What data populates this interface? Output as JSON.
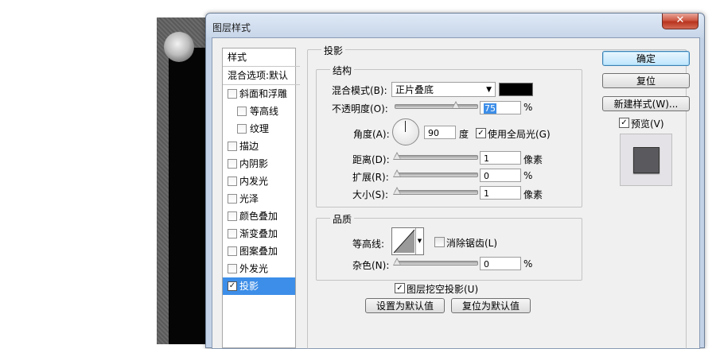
{
  "dialog": {
    "title": "图层样式",
    "close_glyph": "✕",
    "styles_header": "样式",
    "blend_default": "混合选项:默认",
    "style_items": [
      {
        "label": "斜面和浮雕",
        "checked": false
      },
      {
        "label": "等高线",
        "checked": false
      },
      {
        "label": "纹理",
        "checked": false
      },
      {
        "label": "描边",
        "checked": false
      },
      {
        "label": "内阴影",
        "checked": false
      },
      {
        "label": "内发光",
        "checked": false
      },
      {
        "label": "光泽",
        "checked": false
      },
      {
        "label": "颜色叠加",
        "checked": false
      },
      {
        "label": "渐变叠加",
        "checked": false
      },
      {
        "label": "图案叠加",
        "checked": false
      },
      {
        "label": "外发光",
        "checked": false
      },
      {
        "label": "投影",
        "checked": true
      }
    ],
    "check_glyph": "✓"
  },
  "drop_shadow": {
    "group_title": "投影",
    "structure_title": "结构",
    "blend_mode_label": "混合模式(B):",
    "blend_mode_value": "正片叠底",
    "blend_color": "#000000",
    "opacity_label": "不透明度(O):",
    "opacity_value": "75",
    "opacity_unit": "%",
    "angle_label": "角度(A):",
    "angle_value": "90",
    "angle_unit": "度",
    "global_light_label": "使用全局光(G)",
    "global_light_checked": true,
    "distance_label": "距离(D):",
    "distance_value": "1",
    "distance_unit": "像素",
    "spread_label": "扩展(R):",
    "spread_value": "0",
    "spread_unit": "%",
    "size_label": "大小(S):",
    "size_value": "1",
    "size_unit": "像素",
    "quality_title": "品质",
    "contour_label": "等高线:",
    "antialias_label": "消除锯齿(L)",
    "antialias_checked": false,
    "noise_label": "杂色(N):",
    "noise_value": "0",
    "noise_unit": "%",
    "knockout_label": "图层挖空投影(U)",
    "knockout_checked": true,
    "make_default_label": "设置为默认值",
    "reset_default_label": "复位为默认值"
  },
  "actions": {
    "ok_label": "确定",
    "reset_label": "复位",
    "new_style_label": "新建样式(W)...",
    "preview_label": "预览(V)",
    "preview_checked": true
  },
  "colors": {
    "selection": "#3d8ee8",
    "preview_swatch": "#5a5a5e"
  }
}
